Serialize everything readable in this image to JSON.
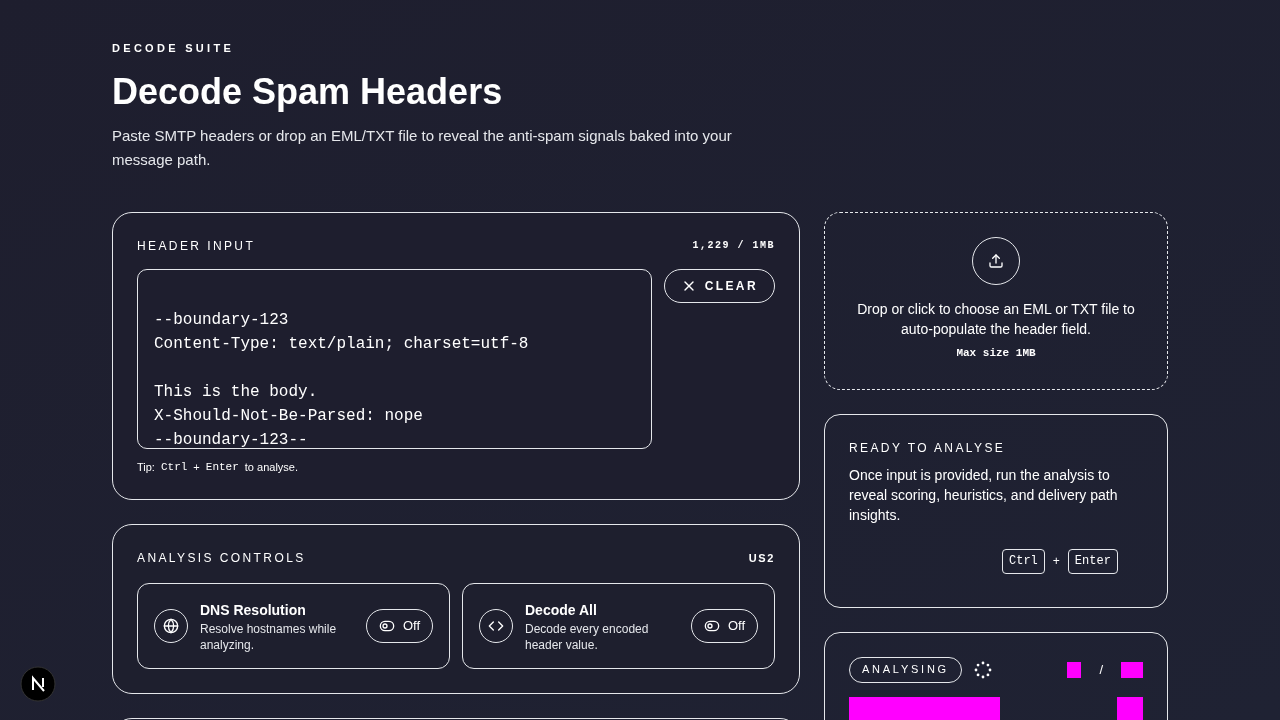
{
  "header": {
    "eyebrow": "DECODE SUITE",
    "title": "Decode Spam Headers",
    "subtitle": "Paste SMTP headers or drop an EML/TXT file to reveal the anti-spam signals baked into your message path."
  },
  "header_input": {
    "title": "HEADER INPUT",
    "count": "1,229 / 1MB",
    "blocks": [
      [
        "--boundary-123",
        "Content-Type: text/plain; charset=utf-8"
      ],
      [
        "This is the body.",
        "X-Should-Not-Be-Parsed: nope",
        "--boundary-123--"
      ]
    ],
    "clear_button": "CLEAR",
    "tip": {
      "prefix": "Tip:",
      "key_1": "Ctrl",
      "plus": "+",
      "key_2": "Enter",
      "suffix": "to analyse."
    }
  },
  "analysis_controls": {
    "title": "ANALYSIS CONTROLS",
    "region": "US2",
    "options": [
      {
        "kind": "globe",
        "title": "DNS Resolution",
        "description": "Resolve hostnames while analyzing.",
        "on": false,
        "state_label": "Off"
      },
      {
        "kind": "code",
        "title": "Decode All",
        "description": "Decode every encoded header value.",
        "on": false,
        "state_label": "Off"
      }
    ]
  },
  "dropzone": {
    "text": "Drop or click to choose an EML or TXT file to auto-populate the header field.",
    "limit": "Max size 1MB"
  },
  "ready_card": {
    "title": "READY TO ANALYSE",
    "text": "Once input is provided, run the analysis to reveal scoring, heuristics, and delivery path insights.",
    "key_1": "Ctrl",
    "plus": "+",
    "key_2": "Enter"
  },
  "status_card": {
    "badge": "ANALYSING",
    "separator": "/"
  }
}
